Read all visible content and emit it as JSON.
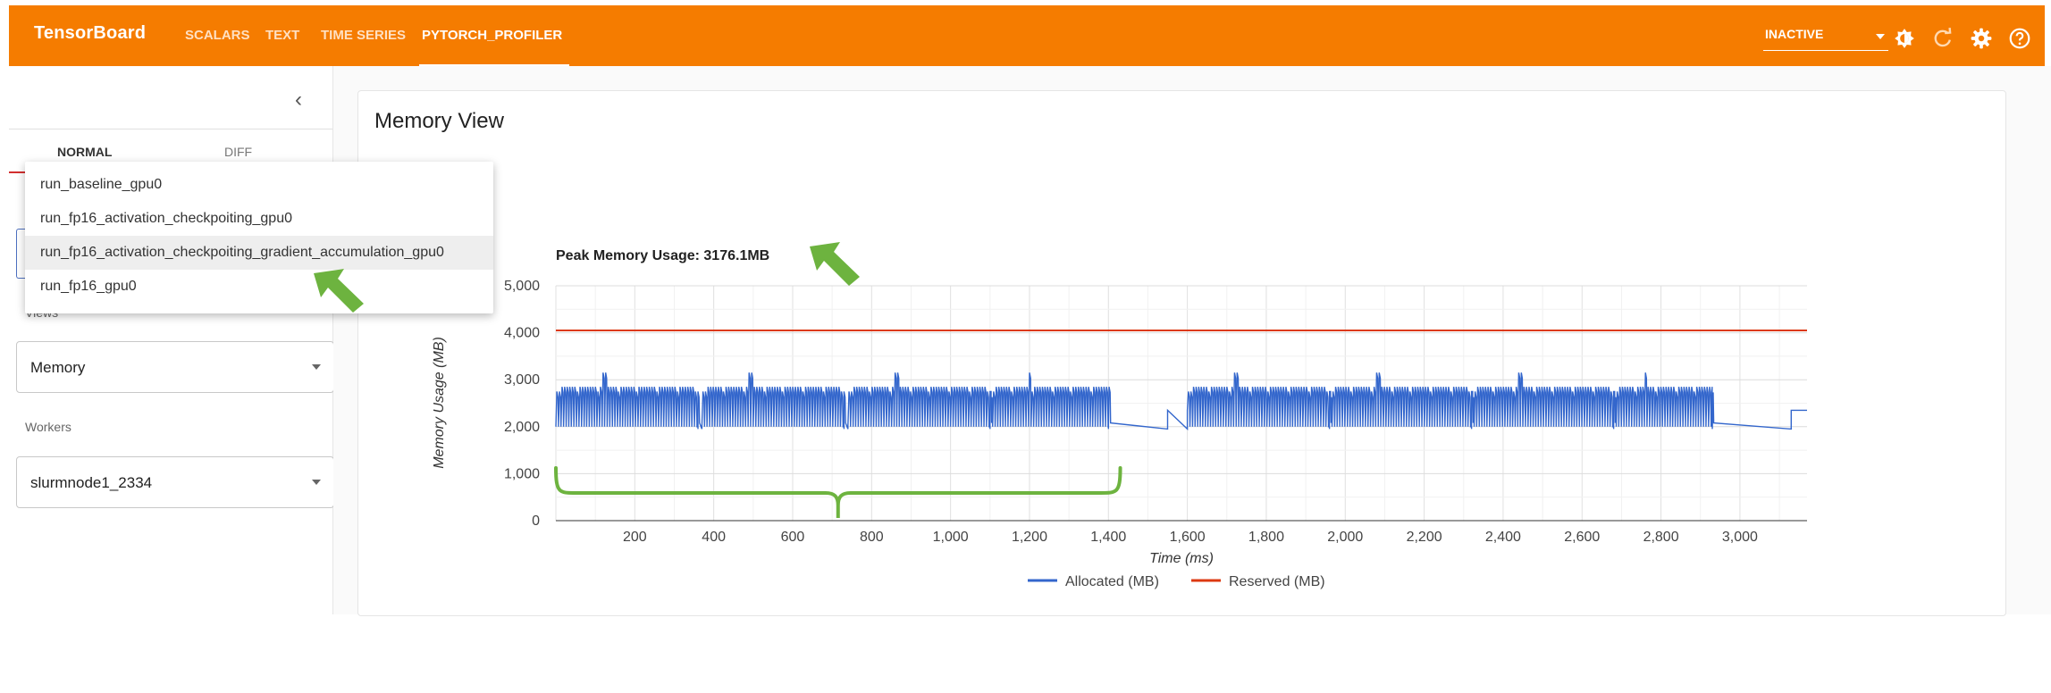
{
  "header": {
    "brand": "TensorBoard",
    "tabs": [
      {
        "label": "SCALARS"
      },
      {
        "label": "TEXT"
      },
      {
        "label": "TIME SERIES"
      },
      {
        "label": "PYTORCH_PROFILER"
      }
    ],
    "active_tab": "PYTORCH_PROFILER",
    "run_status": "INACTIVE",
    "icons": [
      "theme-toggle-icon",
      "refresh-icon",
      "settings-icon",
      "help-icon"
    ],
    "accent": "#f57c00"
  },
  "sidebar": {
    "mode_tabs": [
      {
        "label": "NORMAL"
      },
      {
        "label": "DIFF"
      }
    ],
    "active_mode": "NORMAL",
    "views": {
      "label": "Views",
      "value": "Memory"
    },
    "workers": {
      "label": "Workers",
      "value": "slurmnode1_2334"
    }
  },
  "dropdown": {
    "items": [
      {
        "label": "run_baseline_gpu0"
      },
      {
        "label": "run_fp16_activation_checkpoiting_gpu0"
      },
      {
        "label": "run_fp16_activation_checkpoiting_gradient_accumulation_gpu0"
      },
      {
        "label": "run_fp16_gpu0"
      }
    ],
    "highlighted_index": 2
  },
  "main": {
    "title": "Memory View",
    "peak": "Peak Memory Usage: 3176.1MB"
  },
  "chart_data": {
    "type": "line",
    "xlabel": "Time (ms)",
    "ylabel": "Memory Usage (MB)",
    "xlim": [
      0,
      3170
    ],
    "ylim": [
      0,
      5000
    ],
    "x_ticks": [
      200,
      400,
      600,
      800,
      1000,
      1200,
      1400,
      1600,
      1800,
      2000,
      2200,
      2400,
      2600,
      2800,
      3000
    ],
    "x_tick_labels": [
      "200",
      "400",
      "600",
      "800",
      "1,000",
      "1,200",
      "1,400",
      "1,600",
      "1,800",
      "2,000",
      "2,200",
      "2,400",
      "2,600",
      "2,800",
      "3,000"
    ],
    "y_ticks": [
      0,
      1000,
      2000,
      3000,
      4000,
      5000
    ],
    "y_tick_labels": [
      "0",
      "1,000",
      "2,000",
      "3,000",
      "4,000",
      "5,000"
    ],
    "grid": true,
    "legend_position": "bottom",
    "series": [
      {
        "name": "Allocated (MB)",
        "color": "#3366cc",
        "baseline": 1950,
        "iterations": [
          {
            "start": 0,
            "end": 360,
            "low": 2000,
            "high": 2850,
            "peak": 3150,
            "peak_at": 120
          },
          {
            "start": 370,
            "end": 730,
            "low": 2000,
            "high": 2850,
            "peak": 3150,
            "peak_at": 490
          },
          {
            "start": 740,
            "end": 1100,
            "low": 2000,
            "high": 2850,
            "peak": 3150,
            "peak_at": 860
          },
          {
            "start": 1100,
            "end": 1400,
            "low": 2000,
            "high": 2850,
            "peak": 3150,
            "peak_at": 1200
          },
          {
            "start": 1600,
            "end": 1960,
            "low": 2000,
            "high": 2850,
            "peak": 3150,
            "peak_at": 1720
          },
          {
            "start": 1960,
            "end": 2320,
            "low": 2000,
            "high": 2850,
            "peak": 3150,
            "peak_at": 2080
          },
          {
            "start": 2320,
            "end": 2680,
            "low": 2000,
            "high": 2850,
            "peak": 3150,
            "peak_at": 2440
          },
          {
            "start": 2680,
            "end": 2930,
            "low": 2000,
            "high": 2850,
            "peak": 3150,
            "peak_at": 2760
          }
        ],
        "plateaus": [
          {
            "start": 1400,
            "end": 1550,
            "value": 1950
          },
          {
            "start": 1550,
            "end": 1600,
            "value": 2350
          },
          {
            "start": 2930,
            "end": 3130,
            "value": 1950
          },
          {
            "start": 3130,
            "end": 3170,
            "value": 2350
          }
        ]
      },
      {
        "name": "Reserved (MB)",
        "color": "#dc3912",
        "value": 4050
      }
    ],
    "annotations": [
      {
        "type": "brace",
        "from": 0,
        "to": 1430,
        "color": "#6db33f"
      }
    ]
  }
}
